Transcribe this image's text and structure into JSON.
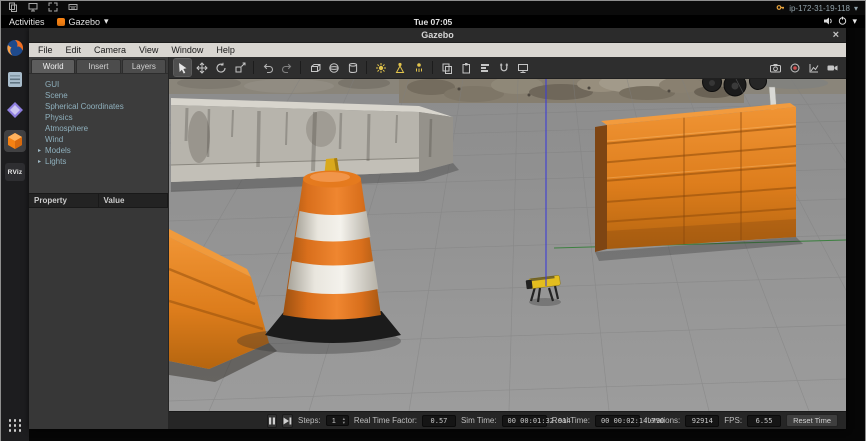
{
  "session_bar": {
    "host": "ip-172-31-19-118"
  },
  "gnome_bar": {
    "activities_label": "Activities",
    "app_menu_label": "Gazebo",
    "clock": "Tue 07:05"
  },
  "dock": {
    "rviz_label": "RViz"
  },
  "window": {
    "title": "Gazebo",
    "menubar": {
      "items": [
        "File",
        "Edit",
        "Camera",
        "View",
        "Window",
        "Help"
      ]
    }
  },
  "left_panel": {
    "tabs": [
      {
        "label": "World"
      },
      {
        "label": "Insert"
      },
      {
        "label": "Layers"
      }
    ],
    "tree": [
      {
        "label": "GUI"
      },
      {
        "label": "Scene"
      },
      {
        "label": "Spherical Coordinates"
      },
      {
        "label": "Physics"
      },
      {
        "label": "Atmosphere"
      },
      {
        "label": "Wind"
      },
      {
        "label": "Models"
      },
      {
        "label": "Lights"
      }
    ],
    "table": {
      "property_header": "Property",
      "value_header": "Value"
    }
  },
  "statusbar": {
    "steps_label": "Steps:",
    "steps_value": "1",
    "rtf_label": "Real Time Factor:",
    "rtf_value": "0.57",
    "sim_time_label": "Sim Time:",
    "sim_time_value": "00 00:01:32.914",
    "real_time_label": "Real Time:",
    "real_time_value": "00 00:02:14.790",
    "iterations_label": "Iterations:",
    "iterations_value": "92914",
    "fps_label": "FPS:",
    "fps_value": "6.55",
    "reset_button": "Reset Time"
  },
  "icons": {
    "chevron_down": "▾",
    "close": "×",
    "tree_expander": "▸",
    "spin_up": "▲",
    "spin_down": "▼"
  },
  "colors": {
    "gazebo_orange": "#e0731c",
    "barrier_orange": "#e2801f",
    "ground_gray": "#929292",
    "marker_blue": "#3d3dd6",
    "axis_green": "#2e7d32",
    "robot_yellow": "#e3bd1f"
  }
}
